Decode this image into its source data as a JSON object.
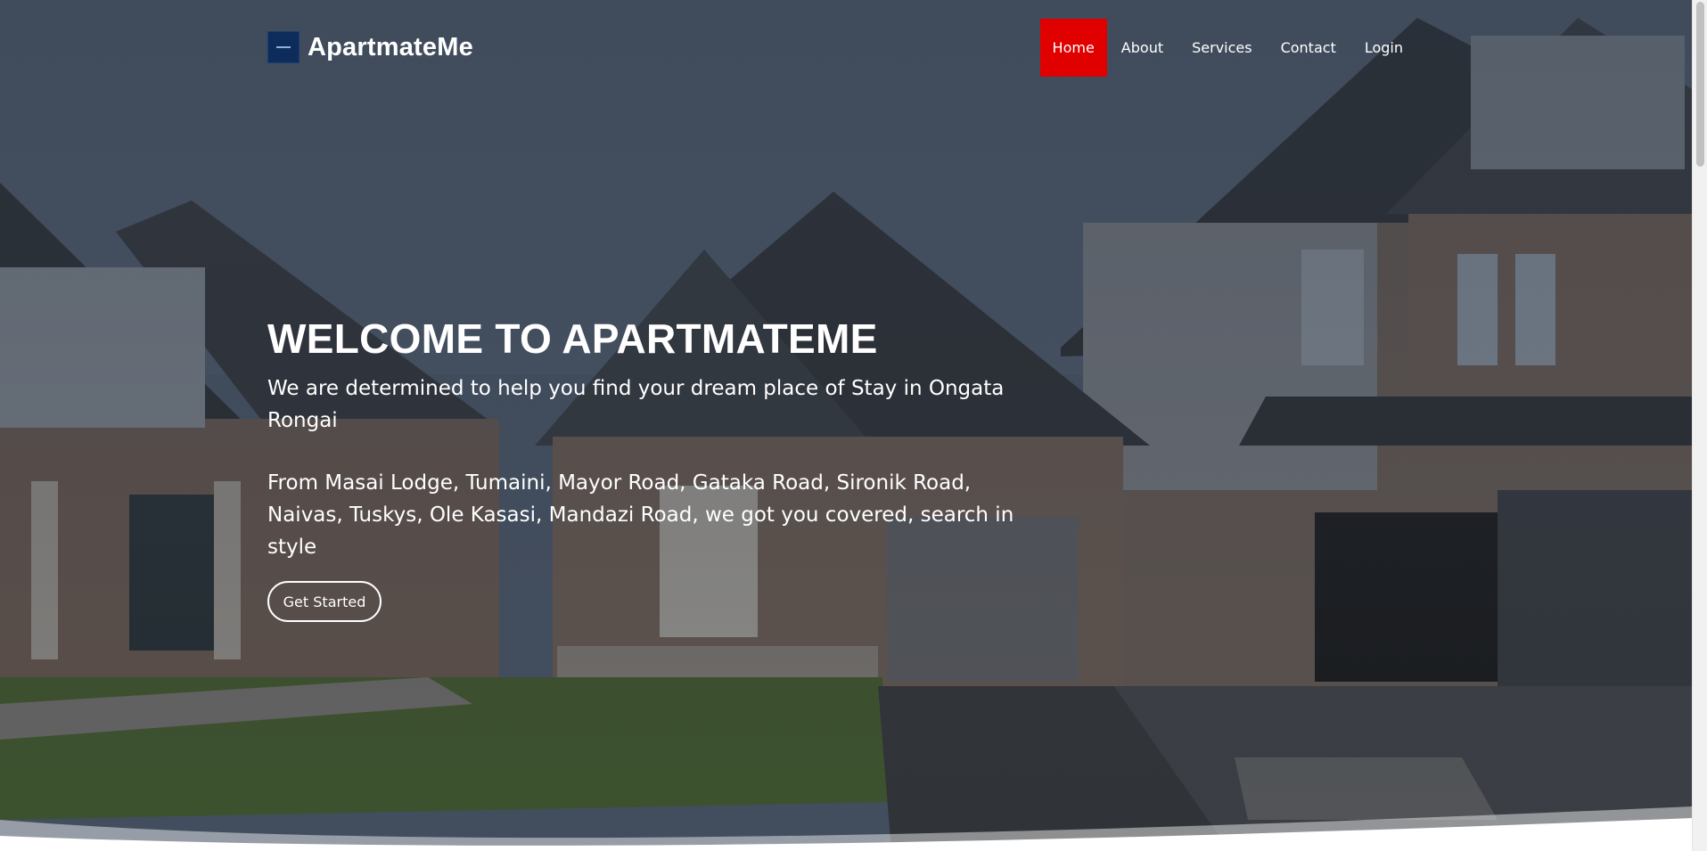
{
  "brand": {
    "name": "ApartmateMe",
    "logo_icon": "apartment-logo-icon"
  },
  "nav": {
    "items": [
      {
        "label": "Home",
        "active": true
      },
      {
        "label": "About",
        "active": false
      },
      {
        "label": "Services",
        "active": false
      },
      {
        "label": "Contact",
        "active": false
      },
      {
        "label": "Login",
        "active": false
      }
    ]
  },
  "hero": {
    "title": "WELCOME TO APARTMATEME",
    "subtitle": "We are determined to help you find your dream place of Stay in Ongata Rongai",
    "description": "From Masai Lodge, Tumaini, Mayor Road, Gataka Road, Sironik Road, Naivas, Tuskys, Ole Kasasi, Mandazi Road, we got you covered, search in style",
    "cta_label": "Get Started"
  },
  "colors": {
    "accent": "#e00000",
    "text": "#ffffff",
    "logo_bg": "#0d2c5c"
  }
}
